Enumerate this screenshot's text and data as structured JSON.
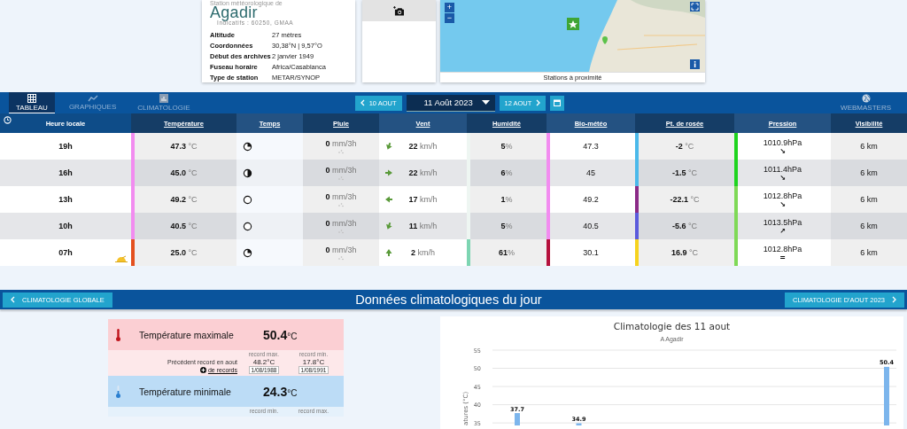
{
  "station": {
    "heading": "Station météorologique de",
    "name": "Agadir",
    "codes": "Indicatifs : 60250, GMAA",
    "facts": [
      {
        "label": "Altitude",
        "value": "27 mètres"
      },
      {
        "label": "Coordonnées",
        "value": "30,38°N | 9,57°O"
      },
      {
        "label": "Début des archives",
        "value": "2 janvier 1949"
      },
      {
        "label": "Fuseau horaire",
        "value": "Africa/Casablanca"
      },
      {
        "label": "Type de station",
        "value": "METAR/SYNOP"
      }
    ]
  },
  "map": {
    "zoom_in": "+",
    "zoom_out": "−",
    "caption": "Stations à proximité"
  },
  "nav": {
    "tabs": [
      {
        "label": "TABLEAU",
        "selected": true,
        "kind": "grid"
      },
      {
        "label": "GRAPHIQUES",
        "selected": false,
        "kind": "line"
      },
      {
        "label": "CLIMATOLOGIE",
        "selected": false,
        "kind": "bars"
      }
    ],
    "prev": "10 AOUT",
    "date": "11 Août 2023",
    "next": "12 AOUT",
    "webmasters": "WEBMASTERS"
  },
  "table": {
    "columns": [
      "Heure locale",
      "Température",
      "Temps",
      "Pluie",
      "Vent",
      "Humidité",
      "Bio-météo",
      "Pt. de rosée",
      "Pression",
      "Visibilité"
    ],
    "rows": [
      {
        "hour": "19h",
        "sunrise": false,
        "temperature": {
          "text": "**47.3** °C",
          "color": "#f28cf0"
        },
        "weather": {
          "kind": "quarter"
        },
        "rain": "**0** mm/3h",
        "wind": {
          "text": "**22** km/h",
          "kind": "down"
        },
        "humidity": {
          "text": "**5**%",
          "color": "#eef6f2"
        },
        "bio": {
          "text": "47.3",
          "color": "#f28cf0"
        },
        "dew": {
          "text": "**-2** °C",
          "color": "#4bb9ea"
        },
        "pressure": {
          "text": "1010.9hPa",
          "trend": "↘",
          "color": "#1ed41e"
        },
        "visibility": "6 km"
      },
      {
        "hour": "16h",
        "sunrise": false,
        "temperature": {
          "text": "**45.0** °C",
          "color": "#f28cf0"
        },
        "weather": {
          "kind": "half"
        },
        "rain": "**0** mm/3h",
        "wind": {
          "text": "**22** km/h",
          "kind": "right"
        },
        "humidity": {
          "text": "**6**%",
          "color": "#eef6f2"
        },
        "bio": {
          "text": "45",
          "color": "#f28cf0"
        },
        "dew": {
          "text": "**-1.5** °C",
          "color": "#4bb9ea"
        },
        "pressure": {
          "text": "1011.4hPa",
          "trend": "↘",
          "color": "#1ed41e"
        },
        "visibility": "6 km"
      },
      {
        "hour": "13h",
        "sunrise": false,
        "temperature": {
          "text": "**49.2** °C",
          "color": "#f28cf0"
        },
        "weather": {
          "kind": "clear"
        },
        "rain": "**0** mm/3h",
        "wind": {
          "text": "**17** km/h",
          "kind": "left"
        },
        "humidity": {
          "text": "**1**%",
          "color": "#eef6f2"
        },
        "bio": {
          "text": "49.2",
          "color": "#f28cf0"
        },
        "dew": {
          "text": "**-22.1** °C",
          "color": "#8b2b87"
        },
        "pressure": {
          "text": "1012.8hPa",
          "trend": "↘",
          "color": "#7fd957"
        },
        "visibility": "6 km"
      },
      {
        "hour": "10h",
        "sunrise": false,
        "temperature": {
          "text": "**40.5** °C",
          "color": "#f28cf0"
        },
        "weather": {
          "kind": "clear"
        },
        "rain": "**0** mm/3h",
        "wind": {
          "text": "**11** km/h",
          "kind": "down"
        },
        "humidity": {
          "text": "**5**%",
          "color": "#eef6f2"
        },
        "bio": {
          "text": "40.5",
          "color": "#f28cf0"
        },
        "dew": {
          "text": "**-5.6** °C",
          "color": "#5b5bdc"
        },
        "pressure": {
          "text": "1013.5hPa",
          "trend": "↗",
          "color": "#7fd957"
        },
        "visibility": "6 km"
      },
      {
        "hour": "07h",
        "sunrise": true,
        "temperature": {
          "text": "**25.0** °C",
          "color": "#e4501e"
        },
        "weather": {
          "kind": "quarter"
        },
        "rain": "**0** mm/3h",
        "wind": {
          "text": "**2** km/h",
          "kind": "up"
        },
        "humidity": {
          "text": "**61**%",
          "color": "#7dd5b2"
        },
        "bio": {
          "text": "30.1",
          "color": "#b5113c"
        },
        "dew": {
          "text": "**16.9** °C",
          "color": "#f6d31e"
        },
        "pressure": {
          "text": "1012.8hPa",
          "trend": "=",
          "color": "#7fd957"
        },
        "visibility": "6 km"
      }
    ]
  },
  "clim_bar": {
    "global": "CLIMATOLOGIE GLOBALE",
    "title": "Données climatologiques du jour",
    "month": "CLIMATOLOGIE D'AOUT 2023"
  },
  "records": [
    {
      "kind": "max",
      "label": "Température maximale",
      "value": "**50.4**°C",
      "col_heads": [
        "record max.",
        "record min."
      ],
      "previous": "Précédent record en aout",
      "more": "de records",
      "records": [
        {
          "value": "48.2°C",
          "date": "1/08/1988"
        },
        {
          "value": "17.8°C",
          "date": "1/08/1991"
        }
      ]
    },
    {
      "kind": "min",
      "label": "Température minimale",
      "value": "**24.3**°C",
      "col_heads": [
        "record min.",
        "record max."
      ]
    }
  ],
  "chart": {
    "subtitle": "A Agadir",
    "chart_data": {
      "type": "bar",
      "title": "Climatologie des 11 aout",
      "ylabel": "atures (°C)",
      "values": [
        37.7,
        34.9,
        null,
        null,
        null,
        null,
        50.4
      ],
      "ylim": [
        34.3,
        55
      ],
      "yticks": [
        35,
        40,
        45,
        50,
        55
      ],
      "grid": true,
      "data_labels": true
    }
  }
}
